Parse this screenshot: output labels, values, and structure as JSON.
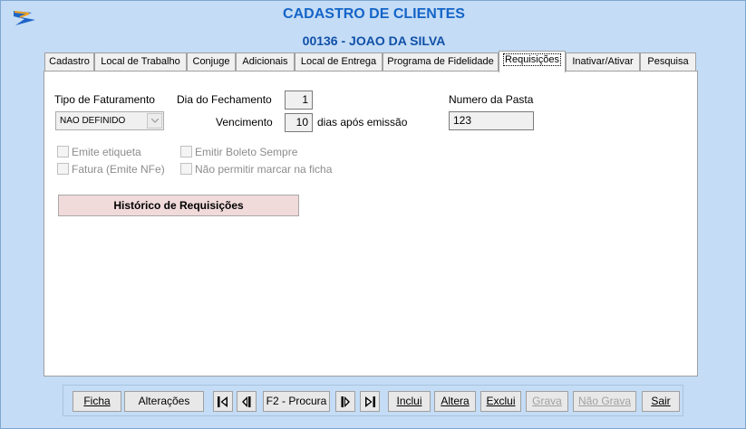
{
  "window": {
    "title": "CADASTRO DE CLIENTES",
    "client_header": "00136 - JOAO DA SILVA"
  },
  "tabs": [
    {
      "label": "Cadastro",
      "active": false
    },
    {
      "label": "Local de Trabalho",
      "active": false
    },
    {
      "label": "Conjuge",
      "active": false
    },
    {
      "label": "Adicionais",
      "active": false
    },
    {
      "label": "Local de Entrega",
      "active": false
    },
    {
      "label": "Programa de Fidelidade",
      "active": false
    },
    {
      "label": "Requisições",
      "active": true
    },
    {
      "label": "Inativar/Ativar",
      "active": false
    },
    {
      "label": "Pesquisa",
      "active": false
    }
  ],
  "form": {
    "tipo_faturamento_label": "Tipo de Faturamento",
    "tipo_faturamento_value": "NAO DEFINIDO",
    "dia_fechamento_label": "Dia do Fechamento",
    "dia_fechamento_value": "1",
    "vencimento_label": "Vencimento",
    "vencimento_value": "10",
    "vencimento_suffix": "dias após emissão",
    "numero_pasta_label": "Numero da Pasta",
    "numero_pasta_value": "123"
  },
  "checkboxes": {
    "emite_etiqueta": "Emite etiqueta",
    "emitir_boleto": "Emitir Boleto Sempre",
    "fatura": "Fatura (Emite NFe)",
    "nao_permitir": "Não permitir marcar na ficha"
  },
  "historico_button": "Histórico de Requisições",
  "footer": {
    "ficha": "Ficha",
    "alteracoes": "Alterações",
    "procura": "F2 - Procura",
    "inclui": "Inclui",
    "altera": "Altera",
    "exclui": "Exclui",
    "grava": "Grava",
    "nao_grava": "Não Grava",
    "sair": "Sair"
  },
  "colors": {
    "window_bg": "#c4dcf5",
    "title_color": "#1464c8",
    "history_button_bg": "#f0dada"
  },
  "icons": [
    "app-logo-icon",
    "first-record-icon",
    "previous-record-icon",
    "next-record-icon",
    "last-record-icon",
    "dropdown-arrow-icon"
  ]
}
